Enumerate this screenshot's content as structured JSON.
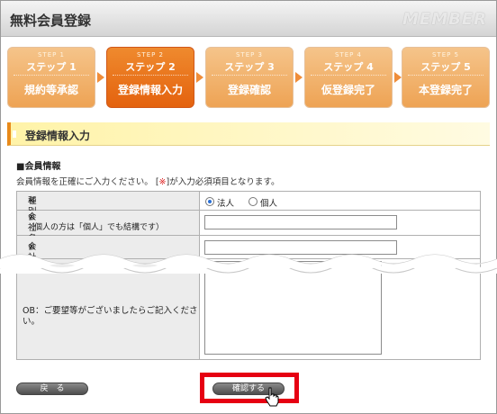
{
  "header": {
    "title": "無料会員登録",
    "badge": "MEMBER"
  },
  "steps": [
    {
      "en": "STEP 1",
      "jp": "ステップ 1",
      "label": "規約等承認",
      "active": false
    },
    {
      "en": "STEP 2",
      "jp": "ステップ 2",
      "label": "登録情報入力",
      "active": true
    },
    {
      "en": "STEP 3",
      "jp": "ステップ 3",
      "label": "登録確認",
      "active": false
    },
    {
      "en": "STEP 4",
      "jp": "ステップ 4",
      "label": "仮登録完了",
      "active": false
    },
    {
      "en": "STEP 5",
      "jp": "ステップ 5",
      "label": "本登録完了",
      "active": false
    }
  ],
  "section": {
    "title": "登録情報入力",
    "subheading": "■会員情報",
    "notice_before": "会員情報を正確にご入力ください。 [",
    "notice_mark": "※",
    "notice_after": "]が入力必須項目となります。"
  },
  "form": {
    "type_label": "種別",
    "required_mark": "※",
    "type_options": [
      "法人",
      "個人"
    ],
    "type_selected": "法人",
    "company_label": "会社名または屋号",
    "company_note": "（個人の方は「個人」でも結構です）",
    "company_value": "",
    "kana_label": "会社名フリガナ",
    "kana_value": "",
    "comment_label": "OB：ご要望等がございましたらご記入ください。",
    "comment_value": ""
  },
  "buttons": {
    "back": "戻　る",
    "confirm": "確認する"
  },
  "colors": {
    "step_active": "#e4620e",
    "step_inactive": "#eea354",
    "highlight": "#e60012",
    "required": "#e02020"
  }
}
